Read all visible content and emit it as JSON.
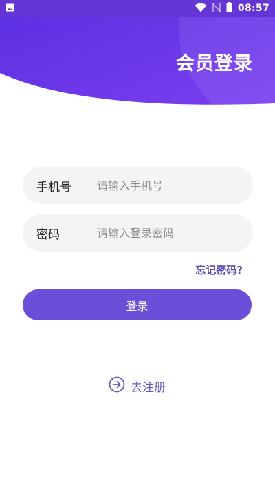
{
  "status_bar": {
    "time": "08:57",
    "left_icon": "image-icon",
    "icons": [
      "wifi-icon",
      "no-sim-icon",
      "battery-icon"
    ]
  },
  "header": {
    "title": "会员登录"
  },
  "form": {
    "phone": {
      "label": "手机号",
      "placeholder": "请输入手机号",
      "value": ""
    },
    "password": {
      "label": "密码",
      "placeholder": "请输入登录密码",
      "value": ""
    },
    "forgot_label": "忘记密码?",
    "login_label": "登录"
  },
  "register": {
    "label": "去注册",
    "icon": "arrow-circle-right-icon"
  },
  "colors": {
    "primary": "#6b4fd9",
    "header_start": "#5a2fe0",
    "header_end": "#7a3ff0",
    "link": "#5b45b8"
  }
}
